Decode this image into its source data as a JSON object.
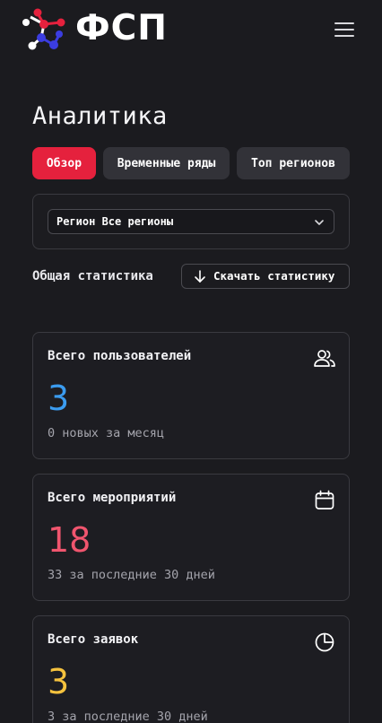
{
  "header": {
    "logo_text": "ФСП"
  },
  "page": {
    "title": "Аналитика"
  },
  "tabs": [
    {
      "label": "Обзор",
      "active": true
    },
    {
      "label": "Временные ряды",
      "active": false
    },
    {
      "label": "Топ регионов",
      "active": false
    }
  ],
  "filter": {
    "region_label": "Регион Все регионы"
  },
  "stats": {
    "section_title": "Общая статистика",
    "download_label": "Скачать статистику"
  },
  "cards": [
    {
      "title": "Всего пользователей",
      "value": "3",
      "subtitle": "0 новых за месяц",
      "icon": "users-icon",
      "color": "#3b9cf0"
    },
    {
      "title": "Всего мероприятий",
      "value": "18",
      "subtitle": "33 за последние 30 дней",
      "icon": "calendar-icon",
      "color": "#f0556e"
    },
    {
      "title": "Всего заявок",
      "value": "3",
      "subtitle": "3 за последние 30 дней",
      "icon": "pie-chart-icon",
      "color": "#f5c23e"
    }
  ],
  "colors": {
    "accent": "#e5213d",
    "background": "#1b1b1f",
    "logo_red": "#e5213d",
    "logo_blue": "#3b3de0"
  }
}
